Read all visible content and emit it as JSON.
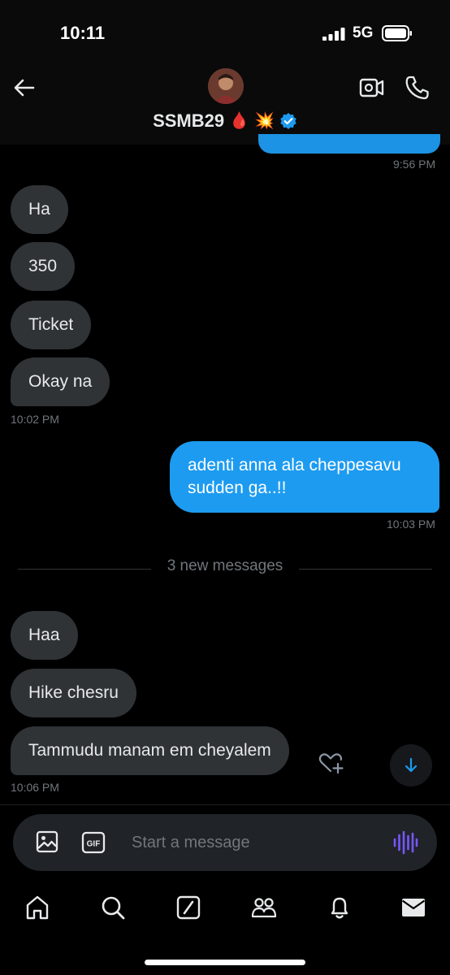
{
  "status_bar": {
    "time": "10:11",
    "network": "5G"
  },
  "header": {
    "contact_name": "SSMB29",
    "name_emojis": [
      "🩸",
      "💥"
    ],
    "verified_badge_color": "#1d9bf0",
    "icons": {
      "back": "arrow-left-icon",
      "video": "video-camera-icon",
      "call": "phone-icon"
    }
  },
  "conversation": {
    "top_timestamp": "9:56 PM",
    "messages_group_1": [
      {
        "text": "Ha",
        "direction": "incoming"
      },
      {
        "text": "350",
        "direction": "incoming"
      },
      {
        "text": "Ticket",
        "direction": "incoming"
      },
      {
        "text": "Okay na",
        "direction": "incoming"
      }
    ],
    "group_1_timestamp": "10:02 PM",
    "outgoing_message": {
      "line1": "adenti anna ala cheppesavu",
      "line2": "sudden ga..!!"
    },
    "outgoing_timestamp": "10:03 PM",
    "new_messages_label": "3 new messages",
    "messages_group_2": [
      {
        "text": "Haa",
        "direction": "incoming"
      },
      {
        "text": "Hike chesru",
        "direction": "incoming"
      },
      {
        "text": "Tammudu manam em cheyalem",
        "direction": "incoming"
      }
    ],
    "group_2_timestamp": "10:06 PM"
  },
  "composer": {
    "placeholder": "Start a message",
    "icons": {
      "media": "image-icon",
      "gif": "gif-icon",
      "voice": "voice-waveform-icon"
    },
    "gif_label": "GIF"
  },
  "tab_bar": {
    "items": [
      "home-icon",
      "search-icon",
      "grok-icon",
      "communities-icon",
      "notifications-icon",
      "messages-icon"
    ],
    "active": "messages-icon"
  },
  "colors": {
    "background": "#000000",
    "incoming_bubble": "#2f3336",
    "outgoing_bubble": "#1d9bf0",
    "muted_text": "#71767b",
    "voice_accent": "#7856ff"
  }
}
